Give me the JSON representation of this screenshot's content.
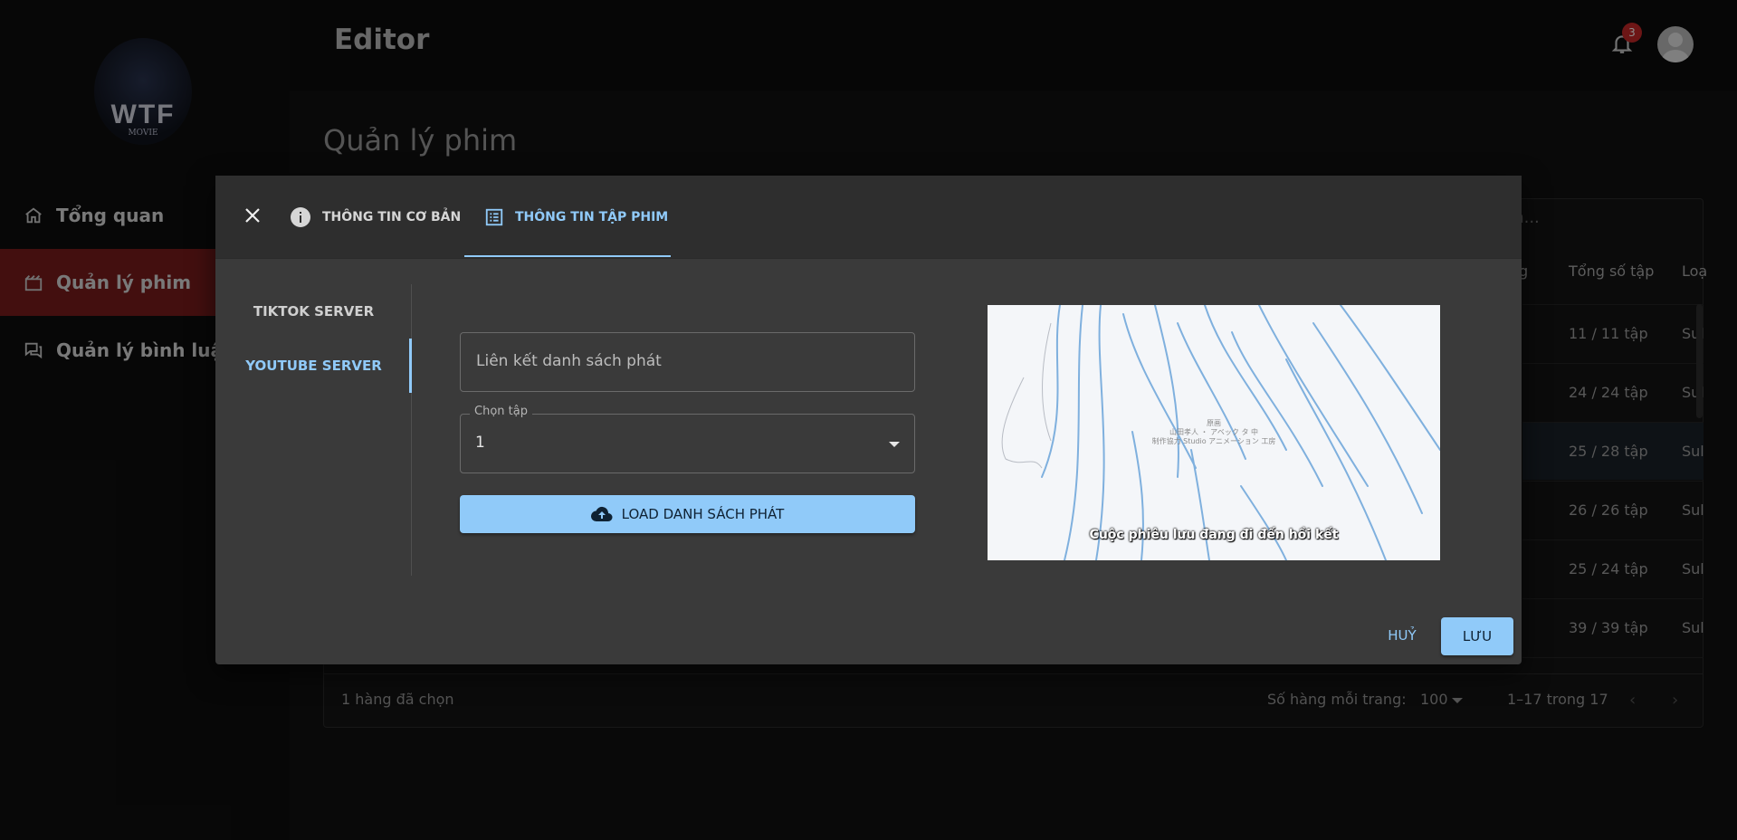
{
  "app": {
    "title": "Editor",
    "notification_count": "3"
  },
  "logo": {
    "text": "WTF",
    "subtext": "MOVIE"
  },
  "sidebar": {
    "items": [
      {
        "label": "Tổng quan",
        "icon": "home-icon"
      },
      {
        "label": "Quản lý phim",
        "icon": "clapperboard-icon",
        "active": true
      },
      {
        "label": "Quản lý bình luận",
        "icon": "comments-icon"
      }
    ]
  },
  "page": {
    "title": "Quản lý phim",
    "search_placeholder": "ếm..."
  },
  "table": {
    "headers": [
      "g",
      "Tổng số tập",
      "Loạ"
    ],
    "episodes": [
      "11 / 11 tập",
      "24 / 24 tập",
      "25 / 28 tập",
      "26 / 26 tập",
      "25 / 24 tập",
      "39 / 39 tập"
    ],
    "type_cells": [
      "Sul",
      "Sul",
      "Sul",
      "Sul",
      "Sul",
      "Sul"
    ],
    "footer": {
      "selected": "1 hàng đã chọn",
      "rows_per_page_label": "Số hàng mỗi trang:",
      "rows_per_page": "100",
      "range": "1–17 trong 17"
    }
  },
  "dialog": {
    "tabs": [
      {
        "label": "THÔNG TIN CƠ BẢN",
        "icon": "info-icon"
      },
      {
        "label": "THÔNG TIN TẬP PHIM",
        "icon": "list-icon",
        "active": true
      }
    ],
    "servers": [
      {
        "label": "TIKTOK SERVER"
      },
      {
        "label": "YOUTUBE SERVER",
        "active": true
      }
    ],
    "playlist_placeholder": "Liên kết danh sách phát",
    "episode_label": "Chọn tập",
    "episode_value": "1",
    "load_button": "LOAD DANH SÁCH PHÁT",
    "video_subtitle": "Cuộc phiêu lưu đang đi đến hồi kết",
    "video_credits": [
      "原画",
      "山田孝人 ・ アベック タ 中",
      "制作協力 Studio アニメーション 工房"
    ],
    "cancel_button": "HUỶ",
    "save_button": "LƯU"
  },
  "colors": {
    "accent": "#90caf9",
    "active_nav": "#7a1d1d",
    "badge": "#c62828"
  }
}
